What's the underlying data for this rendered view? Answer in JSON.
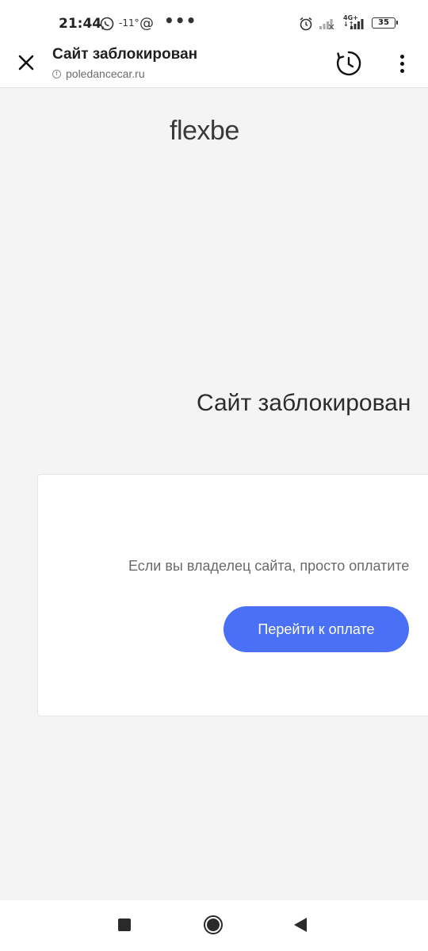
{
  "status_bar": {
    "time": "21:44",
    "temperature": "-11°",
    "at_symbol": "@",
    "more_indicator": "•••",
    "network_label_top": "4G+",
    "network_label_bottom": "↓↑",
    "battery_level": "35",
    "icons": [
      "whatsapp-icon",
      "at-icon",
      "alarm-icon",
      "signal-off-icon",
      "signal-4g-icon",
      "battery-icon"
    ]
  },
  "browser_header": {
    "title": "Сайт заблокирован",
    "url": "poledancecar.ru",
    "icons": [
      "close-icon",
      "info-icon",
      "history-icon",
      "more-vert-icon"
    ]
  },
  "page": {
    "logo_text": "flexbe",
    "heading": "Сайт заблокирован",
    "card": {
      "message": "Если вы владелец сайта, просто оплатите",
      "button_label": "Перейти к оплате",
      "button_color": "#4a70f5"
    },
    "background_color": "#f4f4f4"
  },
  "nav_bar": {
    "icons": [
      "recents-icon",
      "home-icon",
      "back-icon"
    ]
  }
}
